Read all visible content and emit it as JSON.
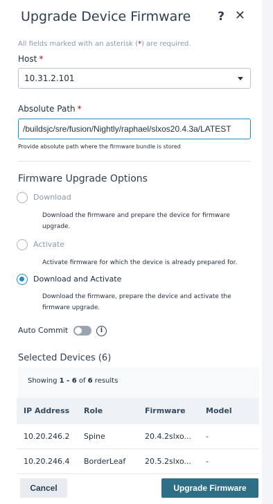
{
  "dialog": {
    "title": "Upgrade Device Firmware",
    "help_glyph": "?",
    "close_glyph": "✕"
  },
  "required_note": {
    "prefix": "All fields marked with an asterisk (",
    "asterisk": "*",
    "suffix": ") are required."
  },
  "host": {
    "label": "Host",
    "required_mark": "*",
    "value": "10.31.2.101"
  },
  "path": {
    "label": "Absolute Path",
    "required_mark": "*",
    "value": "/buildsjc/sre/fusion/Nightly/raphael/slxos20.4.3a/LATEST",
    "hint": "Provide absolute path where the firmware bundle is stored"
  },
  "options": {
    "title": "Firmware Upgrade Options",
    "items": [
      {
        "label": "Download",
        "description": "Download the firmware and prepare the device for firmware upgrade.",
        "checked": false
      },
      {
        "label": "Activate",
        "description": "Activate firmware for which the device is already prepared for.",
        "checked": false
      },
      {
        "label": "Download and Activate",
        "description": "Download the firmware, prepare the device and activate the firmware upgrade.",
        "checked": true
      }
    ]
  },
  "auto_commit": {
    "label": "Auto Commit",
    "enabled": false,
    "info_glyph": "i"
  },
  "devices": {
    "title": "Selected Devices (6)",
    "showing_prefix": "Showing ",
    "range": "1 - 6",
    "of_text": " of ",
    "total": "6",
    "results_suffix": " results",
    "columns": [
      "IP Address",
      "Role",
      "Firmware",
      "Model"
    ],
    "rows": [
      {
        "ip": "10.20.246.2",
        "role": "Spine",
        "firmware": "20.4.2slxo...",
        "model": "-"
      },
      {
        "ip": "10.20.246.4",
        "role": "BorderLeaf",
        "firmware": "20.5.2slxo...",
        "model": "-"
      }
    ]
  },
  "footer": {
    "cancel_label": "Cancel",
    "upgrade_label": "Upgrade Firmware"
  },
  "colors": {
    "accent": "#1a8fc7",
    "primary_button": "#2e6e87",
    "required": "#d0021b"
  }
}
